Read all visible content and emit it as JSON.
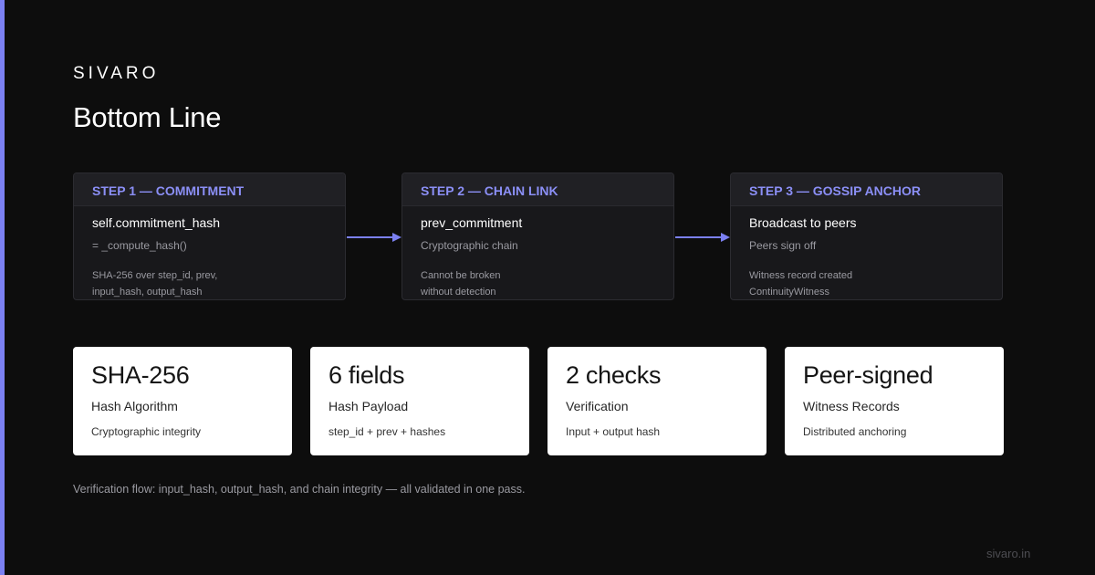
{
  "brand": "SIVARO",
  "title": "Bottom Line",
  "steps": [
    {
      "label": "STEP 1 — COMMITMENT",
      "main": "self.commitment_hash",
      "sub": "= _compute_hash()",
      "note": [
        "SHA-256 over step_id, prev,",
        "input_hash, output_hash"
      ]
    },
    {
      "label": "STEP 2 — CHAIN LINK",
      "main": "prev_commitment",
      "sub": "Cryptographic chain",
      "note": [
        "Cannot be broken",
        "without detection"
      ]
    },
    {
      "label": "STEP 3 — GOSSIP ANCHOR",
      "main": "Broadcast to peers",
      "sub": "Peers sign off",
      "note": [
        "Witness record created",
        "ContinuityWitness"
      ]
    }
  ],
  "stats": [
    {
      "value": "SHA-256",
      "label": "Hash Algorithm",
      "desc": "Cryptographic integrity"
    },
    {
      "value": "6 fields",
      "label": "Hash Payload",
      "desc": "step_id + prev + hashes"
    },
    {
      "value": "2 checks",
      "label": "Verification",
      "desc": "Input + output hash"
    },
    {
      "value": "Peer-signed",
      "label": "Witness Records",
      "desc": "Distributed anchoring"
    }
  ],
  "footnote": "Verification flow: input_hash, output_hash, and chain integrity — all validated in one pass.",
  "site": "sivaro.in",
  "colors": {
    "accent": "#7b80f2",
    "background": "#0d0d0d",
    "card": "#18181b",
    "stat_card": "#ffffff"
  }
}
